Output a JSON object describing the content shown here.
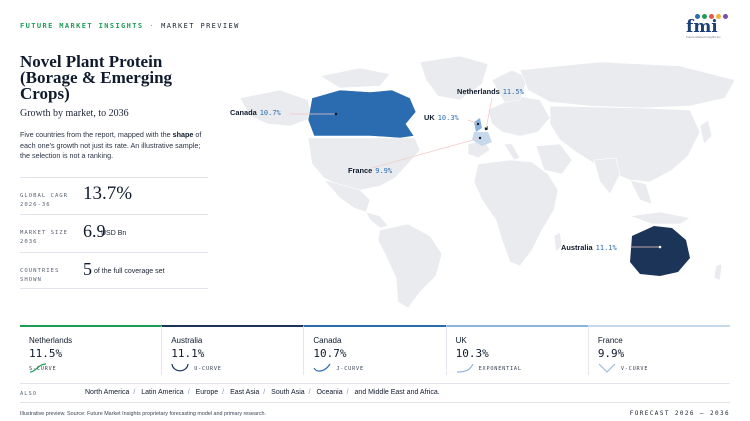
{
  "header": {
    "brand": "FUTURE MARKET INSIGHTS",
    "separator": "·",
    "section": "MARKET PREVIEW"
  },
  "logo": {
    "word": "fmi",
    "sub": "Future Market Insights Inc.",
    "dot_colors": [
      "#2b6cb0",
      "#1f9d57",
      "#e05a4f",
      "#f2b33d",
      "#7a4fb0"
    ]
  },
  "title": "Novel Plant Protein (Borage & Emerging Crops)",
  "subtitle": "Growth by market, to 2036",
  "description": {
    "before": "Five countries from the report, mapped with the ",
    "bold": "shape",
    "after": " of each one's growth not just its rate. An illustrative sample; the selection is not a ranking."
  },
  "stats": [
    {
      "label_line1": "GLOBAL CAGR",
      "label_line2": "2026-36",
      "value": "13.7%",
      "unit": ""
    },
    {
      "label_line1": "MARKET SIZE",
      "label_line2": "2036",
      "value": "6.9",
      "unit": "USD Bn"
    },
    {
      "label_line1": "COUNTRIES",
      "label_line2": "SHOWN",
      "value": "5",
      "unit": "of the full coverage set"
    }
  ],
  "map_labels": [
    {
      "name": "Netherlands",
      "value": "11.5%"
    },
    {
      "name": "Canada",
      "value": "10.7%"
    },
    {
      "name": "UK",
      "value": "10.3%"
    },
    {
      "name": "France",
      "value": "9.9%"
    },
    {
      "name": "Australia",
      "value": "11.1%"
    }
  ],
  "countries": [
    {
      "name": "Netherlands",
      "pct": "11.5%",
      "shape": "S-CURVE",
      "color": "#1f9d57"
    },
    {
      "name": "Australia",
      "pct": "11.1%",
      "shape": "U-CURVE",
      "color": "#1c3457"
    },
    {
      "name": "Canada",
      "pct": "10.7%",
      "shape": "J-CURVE",
      "color": "#2b6cb0"
    },
    {
      "name": "UK",
      "pct": "10.3%",
      "shape": "EXPONENTIAL",
      "color": "#8bb3dd"
    },
    {
      "name": "France",
      "pct": "9.9%",
      "shape": "V-CURVE",
      "color": "#c6d8ec"
    }
  ],
  "also": {
    "label": "ALSO",
    "regions": [
      "North America",
      "Latin America",
      "Europe",
      "East Asia",
      "South Asia",
      "Oceania",
      "and Middle East and Africa."
    ]
  },
  "footer": "Illustrative preview. Source: Future Market Insights proprietary forecasting model and primary research.",
  "forecast": "FORECAST 2026 – 2036"
}
